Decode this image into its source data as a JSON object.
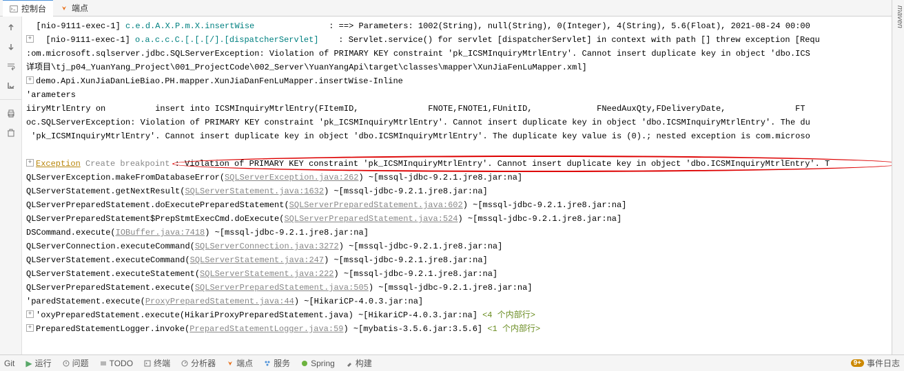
{
  "tabs": {
    "console": "控制台",
    "endpoints": "端点"
  },
  "right_bar": "maven",
  "lines": {
    "l1_pre": "  [nio-9111-exec-1] ",
    "l1_cls": "c.e.d.A.X.P.m.X.insertWise",
    "l1_post": "               : ==> Parameters: 1002(String), null(String), 0(Integer), 4(String), 5.6(Float), 2021-08-24 00:00",
    "l2_pre": "  [nio-9111-exec-1] ",
    "l2_cls": "o.a.c.c.C.[.[.[/].[dispatcherServlet]",
    "l2_post": "    : Servlet.service() for servlet [dispatcherServlet] in context with path [] threw exception [Requ",
    "l3": ":om.microsoft.sqlserver.jdbc.SQLServerException: Violation of PRIMARY KEY constraint 'pk_ICSMInquiryMtrlEntry'. Cannot insert duplicate key in object 'dbo.ICS",
    "l4": "详项目\\tj_p04_YuanYang_Project\\001_ProjectCode\\002_Server\\YuanYangApi\\target\\classes\\mapper\\XunJiaFenLuMapper.xml]",
    "l5": "demo.Api.XunJiaDanLieBiao.PH.mapper.XunJiaDanFenLuMapper.insertWise-Inline",
    "l6": "'arameters",
    "l7": "iiryMtrlEntry on          insert into ICSMInquiryMtrlEntry(FItemID,              FNOTE,FNOTE1,FUnitID,             FNeedAuxQty,FDeliveryDate,              FT",
    "l8": "oc.SQLServerException: Violation of PRIMARY KEY constraint 'pk_ICSMInquiryMtrlEntry'. Cannot insert duplicate key in object 'dbo.ICSMInquiryMtrlEntry'. The du",
    "l9": " 'pk_ICSMInquiryMtrlEntry'. Cannot insert duplicate key in object 'dbo.ICSMInquiryMtrlEntry'. The duplicate key value is (0).; nested exception is com.microso",
    "l10_exc": "Exception",
    "l10_cb": " Create breakpoint ",
    "l10_msg": ": Violation of PRIMARY KEY constraint 'pk_ICSMInquiryMtrlEntry'. Cannot insert duplicate key in object 'dbo.ICSMInquiryMtrlEntry'. T",
    "l11_a": "QLServerException.makeFromDatabaseError(",
    "l11_b": "SQLServerException.java:262",
    "l11_c": ") ~[mssql-jdbc-9.2.1.jre8.jar:na]",
    "l12_a": "QLServerStatement.getNextResult(",
    "l12_b": "SQLServerStatement.java:1632",
    "l12_c": ") ~[mssql-jdbc-9.2.1.jre8.jar:na]",
    "l13_a": "QLServerPreparedStatement.doExecutePreparedStatement(",
    "l13_b": "SQLServerPreparedStatement.java:602",
    "l13_c": ") ~[mssql-jdbc-9.2.1.jre8.jar:na]",
    "l14_a": "QLServerPreparedStatement$PrepStmtExecCmd.doExecute(",
    "l14_b": "SQLServerPreparedStatement.java:524",
    "l14_c": ") ~[mssql-jdbc-9.2.1.jre8.jar:na]",
    "l15_a": "DSCommand.execute(",
    "l15_b": "IOBuffer.java:7418",
    "l15_c": ") ~[mssql-jdbc-9.2.1.jre8.jar:na]",
    "l16_a": "QLServerConnection.executeCommand(",
    "l16_b": "SQLServerConnection.java:3272",
    "l16_c": ") ~[mssql-jdbc-9.2.1.jre8.jar:na]",
    "l17_a": "QLServerStatement.executeCommand(",
    "l17_b": "SQLServerStatement.java:247",
    "l17_c": ") ~[mssql-jdbc-9.2.1.jre8.jar:na]",
    "l18_a": "QLServerStatement.executeStatement(",
    "l18_b": "SQLServerStatement.java:222",
    "l18_c": ") ~[mssql-jdbc-9.2.1.jre8.jar:na]",
    "l19_a": "QLServerPreparedStatement.execute(",
    "l19_b": "SQLServerPreparedStatement.java:505",
    "l19_c": ") ~[mssql-jdbc-9.2.1.jre8.jar:na]",
    "l20_a": "'paredStatement.execute(",
    "l20_b": "ProxyPreparedStatement.java:44",
    "l20_c": ") ~[HikariCP-4.0.3.jar:na]",
    "l21_a": "'oxyPreparedStatement.execute(HikariProxyPreparedStatement.java) ~[HikariCP-4.0.3.jar:na] ",
    "l21_b": "<4 个内部行>",
    "l22_a": "PreparedStatementLogger.invoke(",
    "l22_b": "PreparedStatementLogger.java:59",
    "l22_c": ") ~[mybatis-3.5.6.jar:3.5.6] ",
    "l22_d": "<1 个内部行>"
  },
  "bottom": {
    "git": "Git",
    "run": "运行",
    "problems": "问题",
    "todo": "TODO",
    "terminal": "终端",
    "profiler": "分析器",
    "endpoints": "端点",
    "services": "服务",
    "spring": "Spring",
    "build": "构建",
    "eventlog": "事件日志",
    "badge": "9+"
  }
}
